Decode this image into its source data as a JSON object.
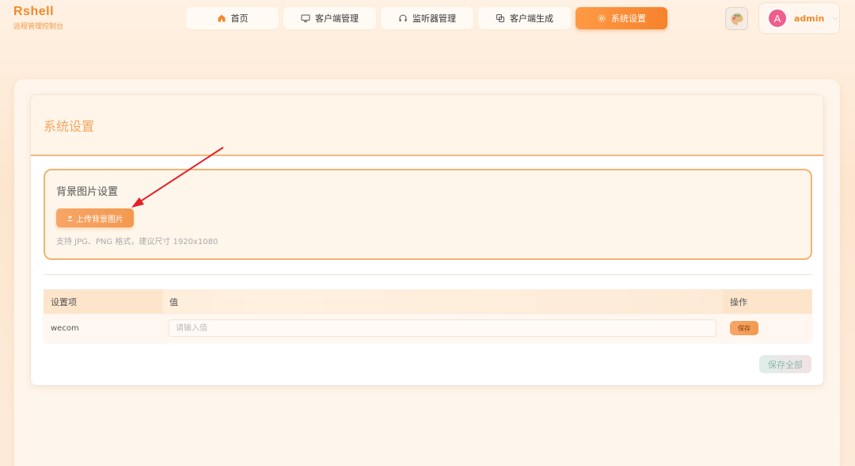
{
  "brand": {
    "title": "Rshell",
    "subtitle": "远程管理控制台"
  },
  "nav": [
    {
      "label": "首页",
      "icon": "home-icon"
    },
    {
      "label": "客户端管理",
      "icon": "monitor-icon"
    },
    {
      "label": "监听器管理",
      "icon": "headphones-icon"
    },
    {
      "label": "客户端生成",
      "icon": "copy-icon"
    },
    {
      "label": "系统设置",
      "icon": "gear-icon",
      "active": true
    }
  ],
  "user": {
    "avatar_letter": "A",
    "name": "admin",
    "caret": "⌵"
  },
  "card": {
    "title": "系统设置"
  },
  "background": {
    "title": "背景图片设置",
    "upload_label": "上传背景图片",
    "hint": "支持 JPG、PNG 格式，建议尺寸 1920x1080"
  },
  "table": {
    "headers": {
      "key": "设置项",
      "value": "值",
      "action": "操作"
    },
    "rows": [
      {
        "key": "wecom",
        "value": "",
        "placeholder": "请输入值",
        "save_label": "保存"
      }
    ]
  },
  "save_all_label": "保存全部",
  "colors": {
    "accent": "#f7822c",
    "brand": "#f08a2e",
    "annotation_arrow": "#e5202a"
  }
}
